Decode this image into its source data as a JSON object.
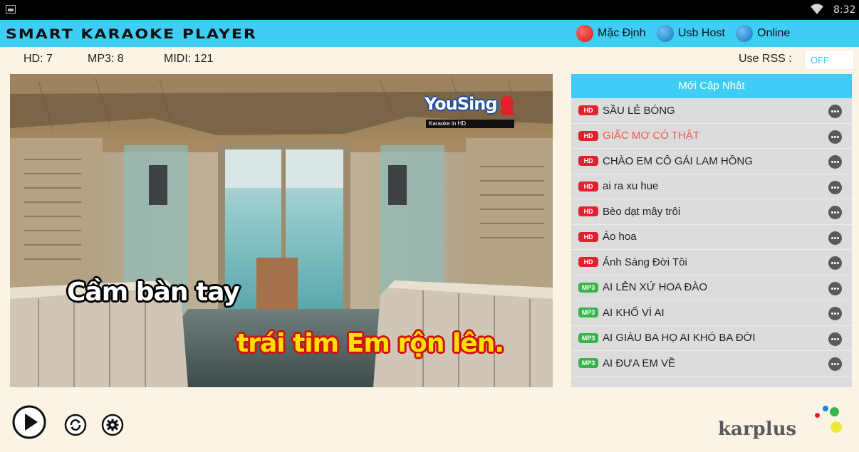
{
  "status_bar": {
    "time": "8:32"
  },
  "header": {
    "title": "SMART KARAOKE PLAYER",
    "sources": [
      {
        "label": "Mặc Định",
        "color": "#e8202a"
      },
      {
        "label": "Usb Host",
        "color": "#1a86d6"
      },
      {
        "label": "Online",
        "color": "#1a86d6"
      }
    ]
  },
  "counts": {
    "hd": "HD: 7",
    "mp3": "MP3: 8",
    "midi": "MIDI: 121"
  },
  "rss": {
    "label": "Use RSS :",
    "value": "OFF"
  },
  "video": {
    "lyric_line1": "Cầm bàn tay",
    "lyric_line2": "trái tim Em rộn lên.",
    "watermark": "YouSing",
    "watermark_sub": "Karaoke in HD"
  },
  "song_list": {
    "header": "Mới Cập Nhật",
    "items": [
      {
        "badge": "HD",
        "title": "SẦU LẺ BÓNG",
        "highlight": false
      },
      {
        "badge": "HD",
        "title": "GIẤC MƠ CÓ THẬT",
        "highlight": true
      },
      {
        "badge": "HD",
        "title": "CHÀO EM CÔ GÁI LAM HỒNG",
        "highlight": false
      },
      {
        "badge": "HD",
        "title": "ai ra xu hue",
        "highlight": false
      },
      {
        "badge": "HD",
        "title": "Bèo dạt mây trôi",
        "highlight": false
      },
      {
        "badge": "HD",
        "title": "Áo hoa",
        "highlight": false
      },
      {
        "badge": "HD",
        "title": "Ánh Sáng Đời Tôi",
        "highlight": false
      },
      {
        "badge": "MP3",
        "title": "AI LÊN XỨ HOA ĐÀO",
        "highlight": false
      },
      {
        "badge": "MP3",
        "title": "AI KHỔ VÌ AI",
        "highlight": false
      },
      {
        "badge": "MP3",
        "title": "AI GIÀU BA HỌ AI KHÓ BA ĐỜI",
        "highlight": false
      },
      {
        "badge": "MP3",
        "title": "AI ĐƯA EM VỀ",
        "highlight": false
      }
    ]
  },
  "controls": {
    "play_icon": "play-icon",
    "repeat_icon": "repeat-icon",
    "settings_icon": "gear-icon"
  },
  "brand": {
    "name": "karplus"
  },
  "colors": {
    "accent": "#3ecdf5",
    "background": "#fbf3e3",
    "hd_badge": "#e0222e",
    "mp3_badge": "#37b54a",
    "highlight_text": "#f0564a"
  }
}
